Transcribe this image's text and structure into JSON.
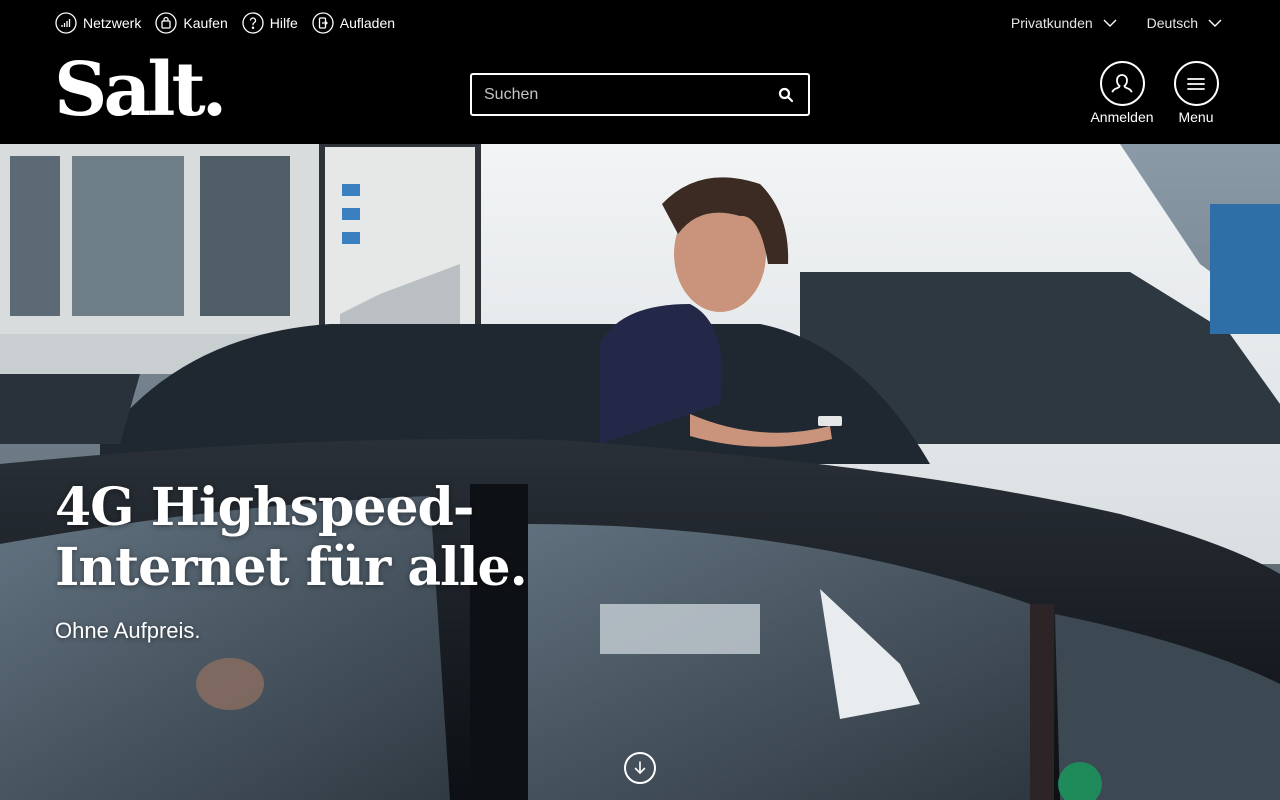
{
  "topnav": {
    "items": [
      {
        "label": "Netzwerk",
        "icon": "signal-icon"
      },
      {
        "label": "Kaufen",
        "icon": "shopping-bag-icon"
      },
      {
        "label": "Hilfe",
        "icon": "help-icon"
      },
      {
        "label": "Aufladen",
        "icon": "top-up-icon"
      }
    ],
    "segment_label": "Privatkunden",
    "language_label": "Deutsch"
  },
  "brand": {
    "logo_text": "Salt."
  },
  "search": {
    "placeholder": "Suchen",
    "value": ""
  },
  "actions": {
    "login_label": "Anmelden",
    "menu_label": "Menu"
  },
  "hero": {
    "headline_line1": "4G Highspeed-",
    "headline_line2": "Internet für alle.",
    "subline": "Ohne Aufpreis."
  },
  "colors": {
    "header_bg": "#000000",
    "text": "#ffffff"
  }
}
